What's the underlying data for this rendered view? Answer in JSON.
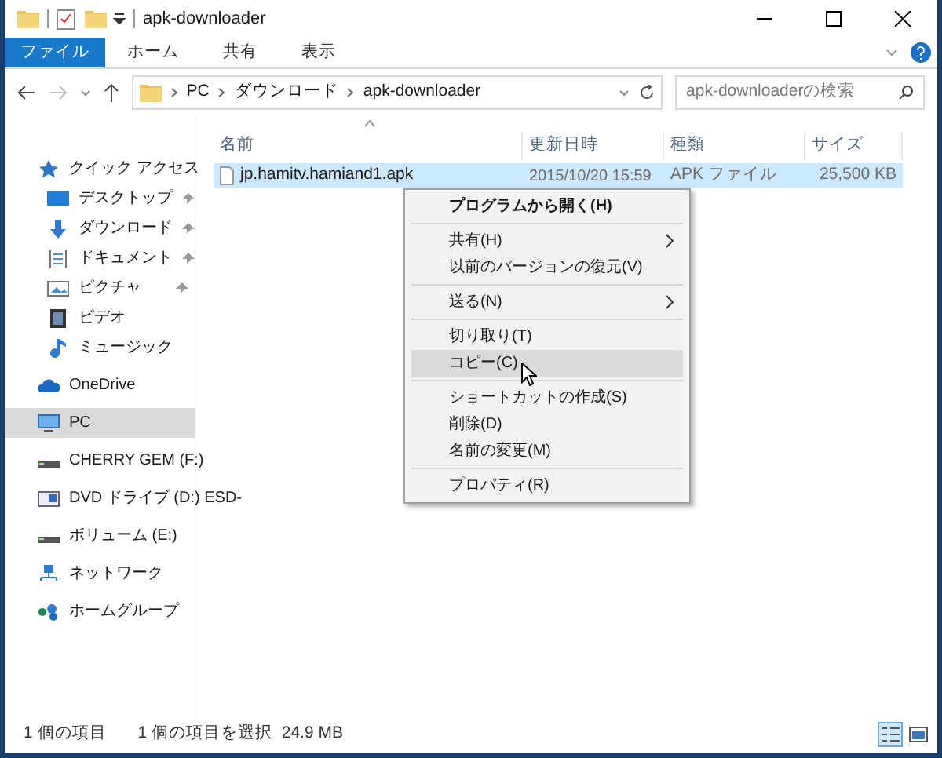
{
  "window": {
    "title": "apk-downloader"
  },
  "ribbon_tabs": [
    {
      "label": "ファイル",
      "kind": "file"
    },
    {
      "label": "ホーム",
      "kind": "tab"
    },
    {
      "label": "共有",
      "kind": "tab"
    },
    {
      "label": "表示",
      "kind": "tab"
    }
  ],
  "address_bar": {
    "crumbs": [
      "PC",
      "ダウンロード",
      "apk-downloader"
    ]
  },
  "search": {
    "placeholder": "apk-downloaderの検索"
  },
  "sidebar": {
    "items": [
      {
        "label": "クイック アクセス",
        "kind": "star",
        "selected": false,
        "children": [
          {
            "label": "デスクトップ",
            "kind": "desktop",
            "pinned": true,
            "selected": false
          },
          {
            "label": "ダウンロード",
            "kind": "download",
            "pinned": true,
            "selected": false
          },
          {
            "label": "ドキュメント",
            "kind": "document",
            "pinned": true,
            "selected": false
          },
          {
            "label": "ピクチャ",
            "kind": "picture",
            "pinned": true,
            "selected": false
          },
          {
            "label": "ビデオ",
            "kind": "video",
            "pinned": false,
            "selected": false
          },
          {
            "label": "ミュージック",
            "kind": "music",
            "pinned": false,
            "selected": false
          }
        ]
      },
      {
        "label": "OneDrive",
        "kind": "cloud",
        "selected": false
      },
      {
        "label": "PC",
        "kind": "pc",
        "selected": true
      },
      {
        "label": "CHERRY GEM (F:)",
        "kind": "drive",
        "selected": false
      },
      {
        "label": "DVD ドライブ (D:) ESD-",
        "kind": "dvd",
        "selected": false
      },
      {
        "label": "ボリューム (E:)",
        "kind": "drive",
        "selected": false
      },
      {
        "label": "ネットワーク",
        "kind": "network",
        "selected": false
      },
      {
        "label": "ホームグループ",
        "kind": "homegroup",
        "selected": false
      }
    ]
  },
  "table": {
    "columns": [
      "名前",
      "更新日時",
      "種類",
      "サイズ"
    ],
    "rows": [
      {
        "name": "jp.hamitv.hamiand1.apk",
        "date": "2015/10/20 15:59",
        "type": "APK ファイル",
        "size": "25,500 KB",
        "selected": true
      }
    ]
  },
  "context_menu": {
    "groups": [
      [
        {
          "label": "プログラムから開く(H)",
          "bold": true,
          "submenu": false,
          "selected": false
        }
      ],
      [
        {
          "label": "共有(H)",
          "bold": false,
          "submenu": true,
          "selected": false
        },
        {
          "label": "以前のバージョンの復元(V)",
          "bold": false,
          "submenu": false,
          "selected": false
        }
      ],
      [
        {
          "label": "送る(N)",
          "bold": false,
          "submenu": true,
          "selected": false
        }
      ],
      [
        {
          "label": "切り取り(T)",
          "bold": false,
          "submenu": false,
          "selected": false
        },
        {
          "label": "コピー(C)",
          "bold": false,
          "submenu": false,
          "selected": true
        }
      ],
      [
        {
          "label": "ショートカットの作成(S)",
          "bold": false,
          "submenu": false,
          "selected": false
        },
        {
          "label": "削除(D)",
          "bold": false,
          "submenu": false,
          "selected": false
        },
        {
          "label": "名前の変更(M)",
          "bold": false,
          "submenu": false,
          "selected": false
        }
      ],
      [
        {
          "label": "プロパティ(R)",
          "bold": false,
          "submenu": false,
          "selected": false
        }
      ]
    ]
  },
  "status_bar": {
    "item_count": "1 個の項目",
    "selection": "1 個の項目を選択  24.9 MB"
  },
  "view_buttons": [
    {
      "kind": "details",
      "selected": true
    },
    {
      "kind": "thumbnails",
      "selected": false
    }
  ]
}
